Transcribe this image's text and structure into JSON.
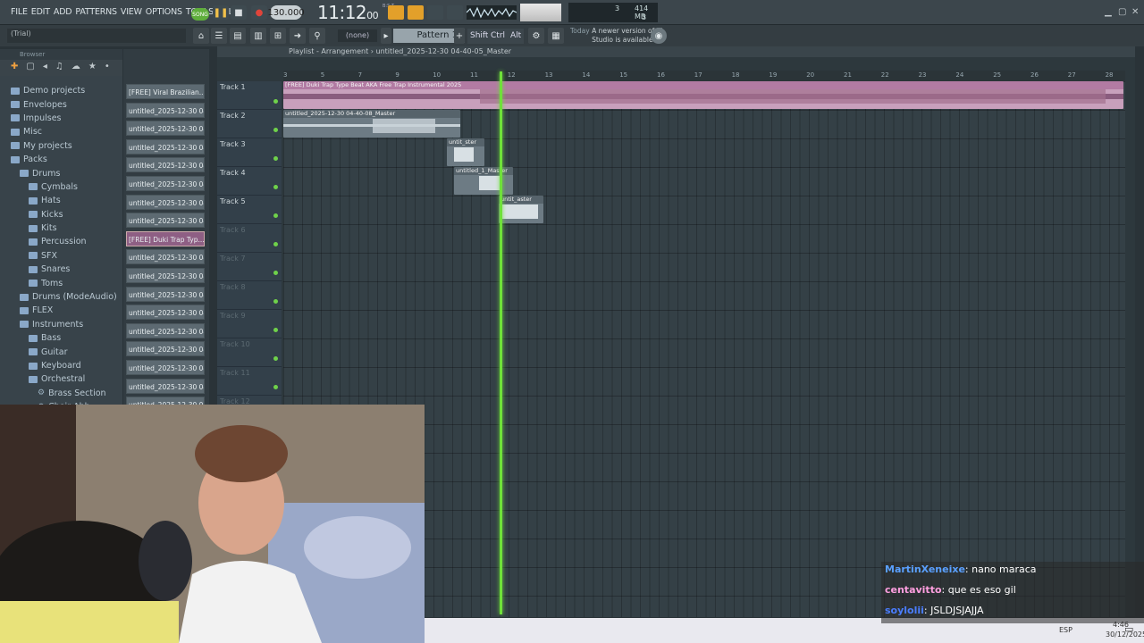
{
  "menu": [
    "FILE",
    "EDIT",
    "ADD",
    "PATTERNS",
    "VIEW",
    "OPTIONS",
    "TOOLS",
    "HELP"
  ],
  "transport": {
    "song_label": "SONG",
    "tempo": "130.000",
    "time": "11:12",
    "time_small": "00",
    "bst": "B:S:T"
  },
  "cpu": {
    "voices": "3",
    "memory": "414 MB",
    "polyphony": "3"
  },
  "hint_text": "(Trial)",
  "toolbar": {
    "snap": "(none)",
    "pattern": "Pattern 1",
    "shift": "Shift",
    "ctrl": "Ctrl",
    "alt": "Alt"
  },
  "news": {
    "today": "Today",
    "text": "A newer version of FL Studio is available!"
  },
  "browser": {
    "title": "Browser",
    "items": [
      {
        "label": "Demo projects",
        "depth": 0,
        "type": "folder"
      },
      {
        "label": "Envelopes",
        "depth": 0,
        "type": "folder"
      },
      {
        "label": "Impulses",
        "depth": 0,
        "type": "folder"
      },
      {
        "label": "Misc",
        "depth": 0,
        "type": "folder"
      },
      {
        "label": "My projects",
        "depth": 0,
        "type": "folder"
      },
      {
        "label": "Packs",
        "depth": 0,
        "type": "folder"
      },
      {
        "label": "Drums",
        "depth": 1,
        "type": "folder"
      },
      {
        "label": "Cymbals",
        "depth": 2,
        "type": "folder"
      },
      {
        "label": "Hats",
        "depth": 2,
        "type": "folder"
      },
      {
        "label": "Kicks",
        "depth": 2,
        "type": "folder"
      },
      {
        "label": "Kits",
        "depth": 2,
        "type": "folder"
      },
      {
        "label": "Percussion",
        "depth": 2,
        "type": "folder"
      },
      {
        "label": "SFX",
        "depth": 2,
        "type": "folder"
      },
      {
        "label": "Snares",
        "depth": 2,
        "type": "folder"
      },
      {
        "label": "Toms",
        "depth": 2,
        "type": "folder"
      },
      {
        "label": "Drums (ModeAudio)",
        "depth": 1,
        "type": "folder"
      },
      {
        "label": "FLEX",
        "depth": 1,
        "type": "folder"
      },
      {
        "label": "Instruments",
        "depth": 1,
        "type": "folder"
      },
      {
        "label": "Bass",
        "depth": 2,
        "type": "folder"
      },
      {
        "label": "Guitar",
        "depth": 2,
        "type": "folder"
      },
      {
        "label": "Keyboard",
        "depth": 2,
        "type": "folder"
      },
      {
        "label": "Orchestral",
        "depth": 2,
        "type": "folder"
      },
      {
        "label": "Brass Section",
        "depth": 3,
        "type": "preset"
      },
      {
        "label": "Choir Ahh",
        "depth": 3,
        "type": "preset"
      }
    ]
  },
  "channels": [
    "[FREE] Viral Brazilian...",
    "untitled_2025-12-30 04-...",
    "untitled_2025-12-30 04-...",
    "untitled_2025-12-30 04-...",
    "untitled_2025-12-30 04-...",
    "untitled_2025-12-30 04-...",
    "untitled_2025-12-30 04-...",
    "untitled_2025-12-30 04-...",
    "[FREE] Duki Trap Typ...",
    "untitled_2025-12-30 04-...",
    "untitled_2025-12-30 04-...",
    "untitled_2025-12-30 04-...",
    "untitled_2025-12-30 04-...",
    "untitled_2025-12-30 04-...",
    "untitled_2025-12-30 04-...",
    "untitled_2025-12-30 04-...",
    "untitled_2025-12-30 04-...",
    "untitled_2025-12-30 04-..."
  ],
  "playlist": {
    "title": "Playlist - Arrangement › untitled_2025-12-30 04-40-05_Master",
    "ruler": [
      "3",
      "5",
      "7",
      "9",
      "10",
      "11",
      "12",
      "13",
      "14",
      "15",
      "16",
      "17",
      "18",
      "19",
      "20",
      "21",
      "22",
      "23",
      "24",
      "25",
      "26",
      "27",
      "28"
    ],
    "tracks": [
      "Track 1",
      "Track 2",
      "Track 3",
      "Track 4",
      "Track 5",
      "Track 6",
      "Track 7",
      "Track 8",
      "Track 9",
      "Track 10",
      "Track 11",
      "Track 12"
    ],
    "clips": [
      {
        "label": "[FREE] Duki Trap Type Beat AKA  Free Trap Instrumental 2025",
        "track": 1
      },
      {
        "label": "untitled_2025-12-30 04-40-08_Master",
        "track": 2
      },
      {
        "label": "untit_ster",
        "track": 3
      },
      {
        "label": "untitled_1_Master",
        "track": 4
      },
      {
        "label": "untit_aster",
        "track": 5
      }
    ]
  },
  "chat": [
    {
      "user": "MartinXeneixe",
      "text": ": nano maraca",
      "color": "#5aa0ff"
    },
    {
      "user": "centavitto",
      "text": ": que es eso gil",
      "color": "#ff9fe0"
    },
    {
      "user": "soylolii",
      "text": ": JSLDJSJAJJA",
      "color": "#4a7dff"
    }
  ],
  "taskbar": {
    "lang": "ESP",
    "time": "4:46",
    "date": "30/12/2025"
  }
}
